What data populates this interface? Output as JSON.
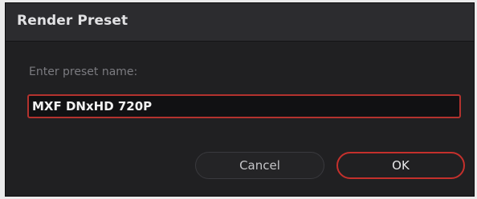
{
  "dialog": {
    "title": "Render Preset",
    "prompt": "Enter preset name:",
    "name_value": "MXF DNxHD 720P",
    "cancel_label": "Cancel",
    "ok_label": "OK"
  },
  "colors": {
    "accent": "#c5302c",
    "background": "#202022",
    "titlebar": "#2c2c2f"
  }
}
